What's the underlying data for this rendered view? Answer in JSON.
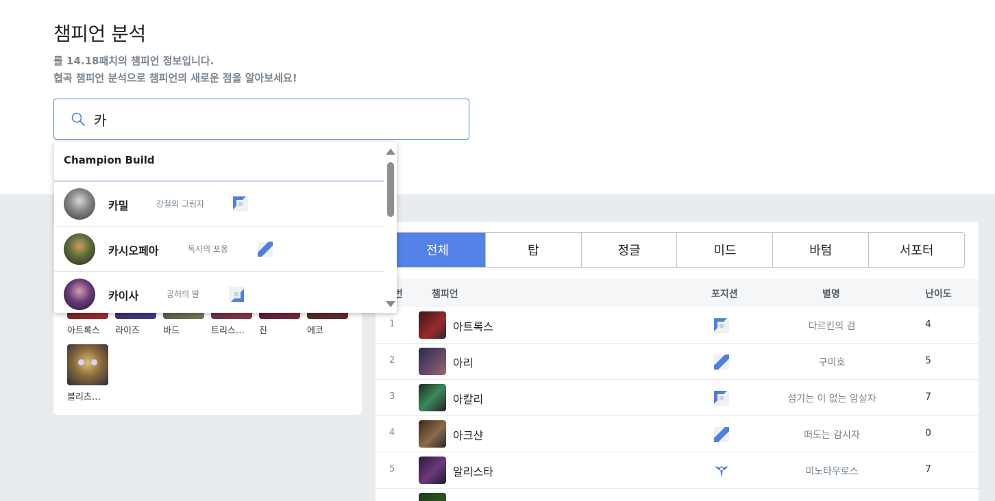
{
  "header": {
    "title": "챔피언 분석",
    "subtitle_line1": "롤 14.18패치의 챔피언 정보입니다.",
    "subtitle_line2": "협곡 챔피언 분석으로 챔피언의 새로운 점을 알아보세요!"
  },
  "search": {
    "value": "카",
    "icon": "search-icon"
  },
  "dropdown": {
    "header": "Champion Build",
    "items": [
      {
        "name": "카밀",
        "title": "강철의 그림자",
        "position": "top"
      },
      {
        "name": "카시오페아",
        "title": "독사의 포옹",
        "position": "mid"
      },
      {
        "name": "카이사",
        "title": "공허의 딸",
        "position": "bottom"
      }
    ]
  },
  "left_panel": {
    "row1_labels": [
      "아트록스",
      "라이즈",
      "바드",
      "트리스…",
      "진",
      "에코"
    ],
    "row2_labels": [
      "블리츠…"
    ]
  },
  "tabs": [
    "전체",
    "탑",
    "정글",
    "미드",
    "바텀",
    "서포터"
  ],
  "active_tab": "전체",
  "table": {
    "headers": {
      "rank": "순번",
      "champion": "챔피언",
      "position": "포지션",
      "alias": "별명",
      "difficulty": "난이도"
    },
    "rows": [
      {
        "rank": "1",
        "name": "아트록스",
        "position": "top",
        "alias": "다르킨의 검",
        "difficulty": "4"
      },
      {
        "rank": "2",
        "name": "아리",
        "position": "mid",
        "alias": "구미호",
        "difficulty": "5"
      },
      {
        "rank": "3",
        "name": "아칼리",
        "position": "top",
        "alias": "섬기는 이 없는 암살자",
        "difficulty": "7"
      },
      {
        "rank": "4",
        "name": "아크샨",
        "position": "mid",
        "alias": "떠도는 감시자",
        "difficulty": "0"
      },
      {
        "rank": "5",
        "name": "알리스타",
        "position": "support",
        "alias": "미노타우로스",
        "difficulty": "7"
      }
    ]
  },
  "colors": {
    "accent": "#5383e8",
    "muted": "#7b858e",
    "background": "#e9ecef"
  }
}
